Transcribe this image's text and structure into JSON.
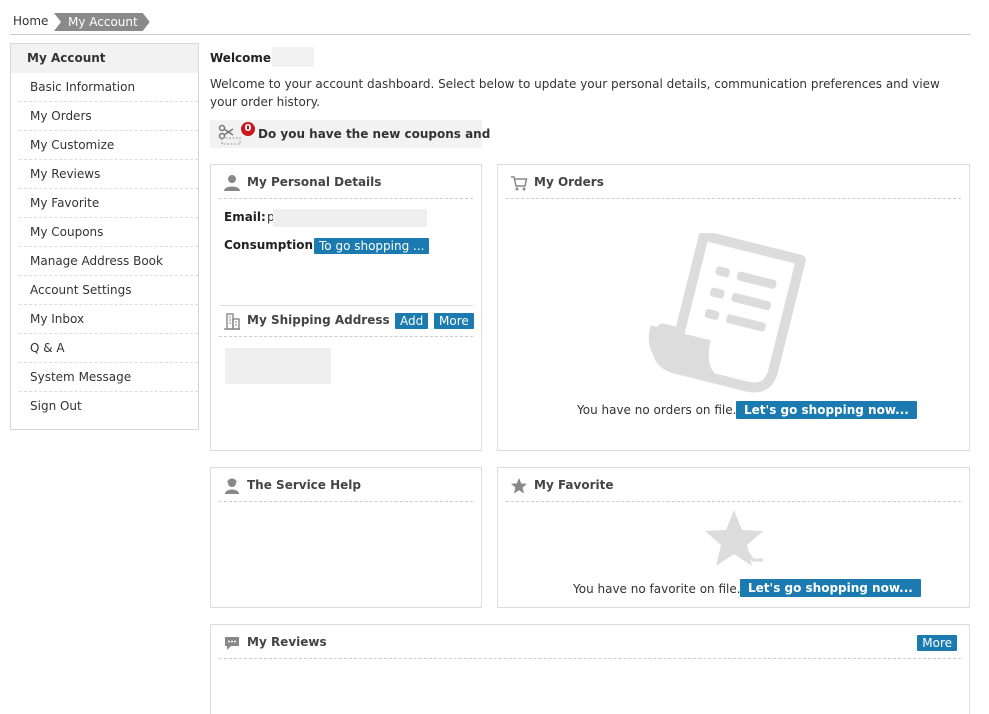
{
  "breadcrumb": {
    "home": "Home",
    "current": "My Account"
  },
  "sidebar": {
    "title": "My Account",
    "items": [
      "Basic Information",
      "My Orders",
      "My Customize",
      "My Reviews",
      "My Favorite",
      "My Coupons",
      "Manage Address Book",
      "Account Settings",
      "My Inbox",
      "Q & A",
      "System Message",
      "Sign Out"
    ]
  },
  "welcome": {
    "title": "Welcome",
    "text": "Welcome to your account dashboard. Select below to update your personal details, communication preferences and view your order history."
  },
  "coupon": {
    "badge": "0",
    "text": "Do you have the new coupons and"
  },
  "personal": {
    "title": "My Personal Details",
    "email_label": "Email:",
    "email_value": "p",
    "consumption_label": "Consumption:",
    "consumption_button": "To go shopping ..."
  },
  "shipping": {
    "title": "My Shipping Address",
    "add": "Add",
    "more": "More"
  },
  "orders": {
    "title": "My Orders",
    "empty": "You have no orders on file.",
    "button": "Let's go shopping now..."
  },
  "service": {
    "title": "The Service Help"
  },
  "favorite": {
    "title": "My Favorite",
    "empty": "You have no favorite on file.",
    "button": "Let's go shopping now..."
  },
  "reviews": {
    "title": "My Reviews",
    "more": "More"
  },
  "colors": {
    "accent": "#1b7bb0",
    "badge": "#c8161d",
    "breadcrumb": "#8a8a8a"
  }
}
